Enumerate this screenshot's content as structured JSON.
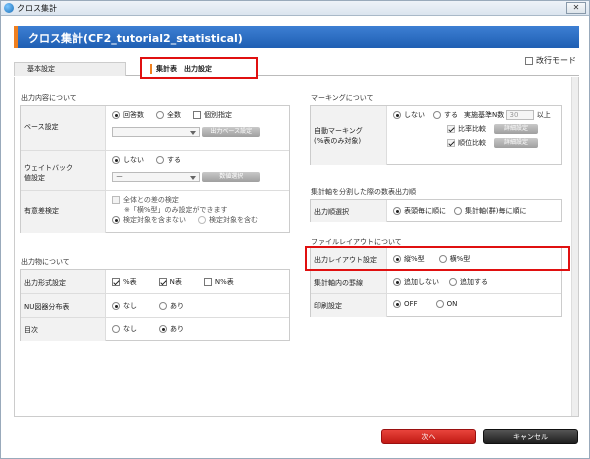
{
  "window": {
    "title": "クロス集計",
    "close": "✕"
  },
  "header": {
    "title": "クロス集計(CF2_tutorial2_statistical)"
  },
  "tabs": {
    "basic": "基本設定",
    "output": "集計表　出力設定"
  },
  "line_mode": "改行モード",
  "left": {
    "sec1": "出力内容について",
    "base": {
      "label": "ベース設定",
      "opt1": "回答数",
      "opt2": "全数",
      "opt3": "個別指定",
      "btn": "出力ベース設定"
    },
    "weight": {
      "label": "ウェイトバック\n値設定",
      "opt1": "しない",
      "opt2": "する",
      "select": "ー",
      "btn": "数値選択"
    },
    "sig": {
      "label": "有意差検定",
      "line1": "全体との差の検定",
      "line2": "※「横%型」のみ設定ができます",
      "opt1": "検定対象を含まない",
      "opt2": "検定対象を含む"
    },
    "sec2": "出力物について",
    "format": {
      "label": "出力形式設定",
      "opt1": "%表",
      "opt2": "N表",
      "opt3": "N%表"
    },
    "nu": {
      "label": "NU図器分布表",
      "opt1": "なし",
      "opt2": "あり"
    },
    "toc": {
      "label": "目次",
      "opt1": "なし",
      "opt2": "あり"
    }
  },
  "right": {
    "sec1": "マーキングについて",
    "auto": {
      "label": "自動マーキング\n(%表のみ対象)",
      "opt1": "しない",
      "opt2": "する",
      "base_label": "実施基準N数",
      "base_value": "30",
      "base_suffix": "以上",
      "ratio": "比率比較",
      "rank": "順位比較",
      "btn": "詳細設定"
    },
    "sec2": "集計軸を分割した際の数表出力順",
    "order": {
      "label": "出力順選択",
      "opt1": "表頭毎に順に",
      "opt2": "集計軸(群)毎に順に"
    },
    "sec3": "ファイルレイアウトについて",
    "layout": {
      "label": "出力レイアウト設定",
      "opt1": "縦%型",
      "opt2": "横%型"
    },
    "axis": {
      "label": "集計軸内の罫線",
      "opt1": "追加しない",
      "opt2": "追加する"
    },
    "print": {
      "label": "印刷設定",
      "opt1": "OFF",
      "opt2": "ON"
    }
  },
  "footer": {
    "next": "次へ",
    "cancel": "キャンセル"
  }
}
